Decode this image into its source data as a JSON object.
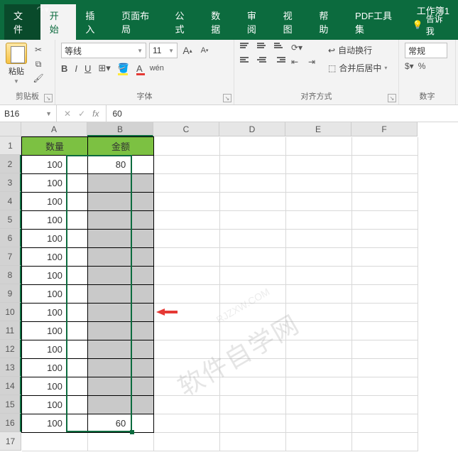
{
  "app": {
    "title": "工作簿1"
  },
  "tabs": {
    "file": "文件",
    "home": "开始",
    "insert": "插入",
    "pagelayout": "页面布局",
    "formulas": "公式",
    "data": "数据",
    "review": "审阅",
    "view": "视图",
    "help": "帮助",
    "pdf": "PDF工具集",
    "tellme": "告诉我"
  },
  "ribbon": {
    "clipboard": {
      "paste": "粘贴",
      "label": "剪贴板"
    },
    "font": {
      "name": "等线",
      "size": "11",
      "bold": "B",
      "italic": "I",
      "underline": "U",
      "wen": "wén",
      "sizeup": "A",
      "sizedown": "A",
      "label": "字体"
    },
    "align": {
      "wrap": "自动换行",
      "merge": "合并后居中",
      "label": "对齐方式"
    },
    "number": {
      "format": "常规",
      "label": "数字"
    }
  },
  "formulabar": {
    "namebox": "B16",
    "fx": "fx",
    "value": "60"
  },
  "grid": {
    "cols": [
      "A",
      "B",
      "C",
      "D",
      "E",
      "F"
    ],
    "rows": [
      "1",
      "2",
      "3",
      "4",
      "5",
      "6",
      "7",
      "8",
      "9",
      "10",
      "11",
      "12",
      "13",
      "14",
      "15",
      "16",
      "17"
    ],
    "headers": {
      "A": "数量",
      "B": "金额"
    },
    "dataA": [
      "100",
      "100",
      "100",
      "100",
      "100",
      "100",
      "100",
      "100",
      "100",
      "100",
      "100",
      "100",
      "100",
      "100",
      "100"
    ],
    "dataB": [
      "80",
      "",
      "",
      "",
      "",
      "",
      "",
      "",
      "",
      "",
      "",
      "",
      "",
      "",
      "60"
    ]
  },
  "watermark": {
    "main": "软件自学网",
    "sub": "RJZXW.COM"
  }
}
